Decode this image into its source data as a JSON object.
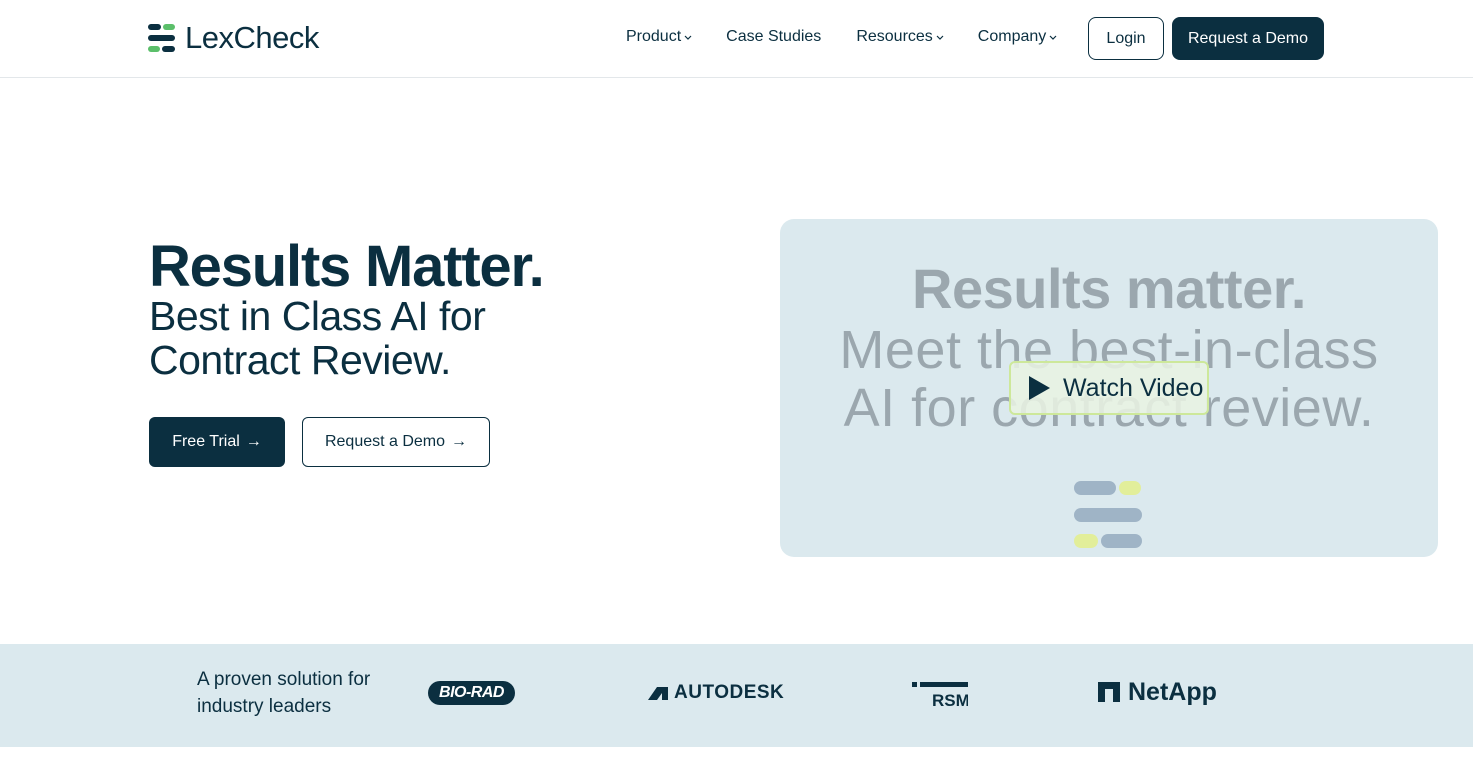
{
  "brand": {
    "name": "LexCheck",
    "colors": {
      "navy": "#0b2f40",
      "green": "#5bbf6a",
      "lime": "#d9ec7a",
      "card_bg": "#dbe9ee"
    }
  },
  "nav": {
    "items": [
      {
        "label": "Product",
        "has_dropdown": true
      },
      {
        "label": "Case Studies",
        "has_dropdown": false
      },
      {
        "label": "Resources",
        "has_dropdown": true
      },
      {
        "label": "Company",
        "has_dropdown": true
      }
    ],
    "login_label": "Login",
    "demo_label": "Request a Demo"
  },
  "hero": {
    "title": "Results Matter.",
    "subtitle": "Best in Class AI for Contract Review.",
    "free_trial_label": "Free Trial",
    "demo_label": "Request a Demo",
    "arrow": "→"
  },
  "video": {
    "title": "Results matter.",
    "line1": "Meet the best-in-class",
    "line2": "AI for contract review.",
    "watch_label": "Watch Video"
  },
  "clients": {
    "tagline": "A proven solution for industry leaders",
    "logos": [
      "BIO-RAD",
      "AUTODESK",
      "RSM",
      "NetApp"
    ]
  },
  "icons": [
    "lexcheck-logo-icon",
    "chevron-down-icon",
    "arrow-right-icon",
    "play-icon",
    "autodesk-icon",
    "netapp-icon"
  ]
}
